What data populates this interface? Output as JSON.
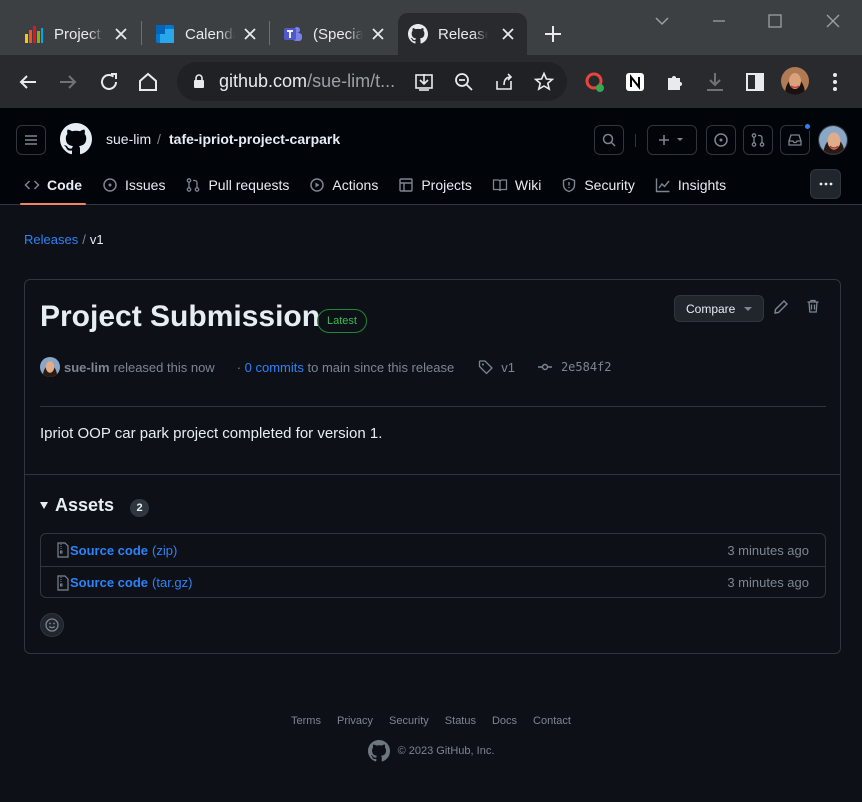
{
  "browser": {
    "tabs": [
      {
        "title": "Project",
        "icon": "bar-chart-favicon"
      },
      {
        "title": "Calendar",
        "icon": "calendar-favicon"
      },
      {
        "title": "(Special",
        "icon": "teams-favicon"
      },
      {
        "title": "Releases",
        "icon": "github-favicon",
        "active": true
      }
    ],
    "url_host": "github.com",
    "url_path": "/sue-lim/t..."
  },
  "header": {
    "owner": "sue-lim",
    "separator": "/",
    "repo": "tafe-ipriot-project-carpark"
  },
  "repo_nav": [
    {
      "label": "Code",
      "icon": "code-icon",
      "selected": true
    },
    {
      "label": "Issues",
      "icon": "issue-icon"
    },
    {
      "label": "Pull requests",
      "icon": "pull-request-icon"
    },
    {
      "label": "Actions",
      "icon": "play-icon"
    },
    {
      "label": "Projects",
      "icon": "table-icon"
    },
    {
      "label": "Wiki",
      "icon": "book-icon"
    },
    {
      "label": "Security",
      "icon": "shield-icon"
    },
    {
      "label": "Insights",
      "icon": "graph-icon"
    }
  ],
  "breadcrumb": {
    "parent": "Releases",
    "separator": "/",
    "current": "v1"
  },
  "release": {
    "title": "Project Submission",
    "badge": "Latest",
    "compare_label": "Compare",
    "author": "sue-lim",
    "released_text": "released this now",
    "commits_prefix": "·",
    "commits_link": "0 commits",
    "commits_suffix": "to main since this release",
    "tag": "v1",
    "commit_sha": "2e584f2",
    "body": "Ipriot OOP car park project completed for version 1."
  },
  "assets": {
    "label": "Assets",
    "count": "2",
    "items": [
      {
        "name": "Source code",
        "ext": "(zip)",
        "time": "3 minutes ago"
      },
      {
        "name": "Source code",
        "ext": "(tar.gz)",
        "time": "3 minutes ago"
      }
    ]
  },
  "footer": {
    "links": [
      "Terms",
      "Privacy",
      "Security",
      "Status",
      "Docs",
      "Contact"
    ],
    "copyright": "© 2023 GitHub, Inc."
  },
  "colors": {
    "background": "#0d1117",
    "link": "#2f81f7",
    "latest_badge": "#3fb950",
    "nav_underline": "#f78166",
    "notification_dot": "#2f81f7"
  }
}
